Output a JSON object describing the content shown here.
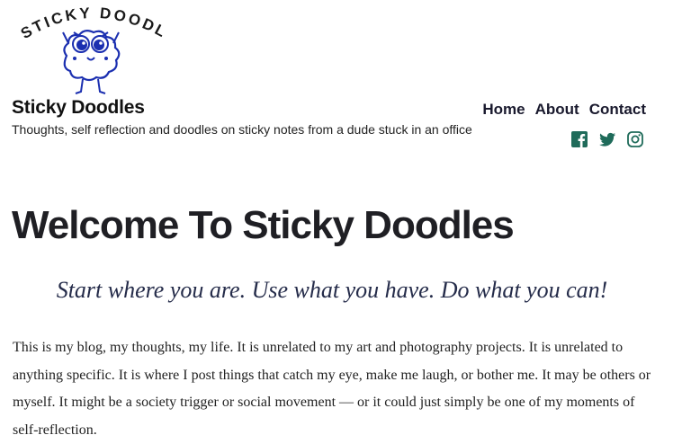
{
  "header": {
    "logo_text": "STICKY DOODLES",
    "site_title": "Sticky Doodles",
    "tagline": "Thoughts, self reflection and doodles on sticky notes from a dude stuck in an office"
  },
  "nav": {
    "items": [
      {
        "label": "Home"
      },
      {
        "label": "About"
      },
      {
        "label": "Contact"
      }
    ]
  },
  "social": {
    "icons": [
      "facebook-icon",
      "twitter-icon",
      "instagram-icon"
    ],
    "color": "#1f6b5a"
  },
  "main": {
    "heading": "Welcome To Sticky Doodles",
    "quote": "Start where you are. Use what you have. Do what you can!",
    "body": "This is my blog, my thoughts, my life.  It is unrelated to my art and photography projects.  It is unrelated to anything specific. It is where I post things  that catch my eye, make me laugh, or bother me.  It may be others or myself.  It might be a society trigger or social movement — or it could just simply be one of my moments of self-reflection."
  }
}
